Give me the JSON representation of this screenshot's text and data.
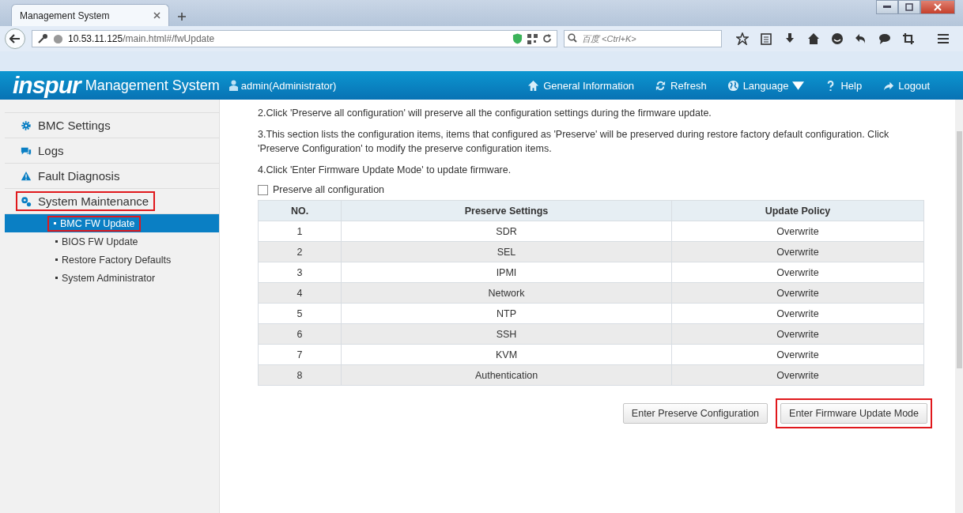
{
  "browser": {
    "tab": {
      "title": "Management System"
    },
    "url_host": "10.53.11.125",
    "url_path": "/main.html#/fwUpdate",
    "search": {
      "placeholder": "百度 <Ctrl+K>"
    }
  },
  "header": {
    "brand": "inspur",
    "title": "Management System",
    "user": "admin(Administrator)",
    "nav": [
      {
        "label": "General Information",
        "dropdown": false
      },
      {
        "label": "Refresh",
        "dropdown": false
      },
      {
        "label": "Language",
        "dropdown": true
      },
      {
        "label": "Help",
        "dropdown": false
      },
      {
        "label": "Logout",
        "dropdown": false
      }
    ]
  },
  "sidebar": {
    "items": [
      {
        "label": "BMC Settings",
        "highlighted": false
      },
      {
        "label": "Logs",
        "highlighted": false
      },
      {
        "label": "Fault Diagnosis",
        "highlighted": false
      },
      {
        "label": "System Maintenance",
        "highlighted": true,
        "children": [
          {
            "label": "BMC FW Update",
            "selected": true,
            "highlighted": true
          },
          {
            "label": "BIOS FW Update",
            "selected": false,
            "highlighted": false
          },
          {
            "label": "Restore Factory Defaults",
            "selected": false,
            "highlighted": false
          },
          {
            "label": "System Administrator",
            "selected": false,
            "highlighted": false
          }
        ]
      }
    ]
  },
  "notes": [
    "2.Click 'Preserve all configuration' will preserve all the configuration settings during the firmware update.",
    "3.This section lists the configuration items, items that configured as 'Preserve' will be preserved during restore factory default configuration. Click 'Preserve Configuration' to modify the preserve configuration items.",
    "4.Click 'Enter Firmware Update Mode' to update firmware."
  ],
  "preserve_all": {
    "label": "Preserve all configuration",
    "checked": false
  },
  "table": {
    "columns": [
      "NO.",
      "Preserve Settings",
      "Update Policy"
    ],
    "rows": [
      [
        "1",
        "SDR",
        "Overwrite"
      ],
      [
        "2",
        "SEL",
        "Overwrite"
      ],
      [
        "3",
        "IPMI",
        "Overwrite"
      ],
      [
        "4",
        "Network",
        "Overwrite"
      ],
      [
        "5",
        "NTP",
        "Overwrite"
      ],
      [
        "6",
        "SSH",
        "Overwrite"
      ],
      [
        "7",
        "KVM",
        "Overwrite"
      ],
      [
        "8",
        "Authentication",
        "Overwrite"
      ]
    ]
  },
  "buttons": [
    {
      "label": "Enter Preserve Configuration",
      "highlighted": false
    },
    {
      "label": "Enter Firmware Update Mode",
      "highlighted": true
    }
  ]
}
